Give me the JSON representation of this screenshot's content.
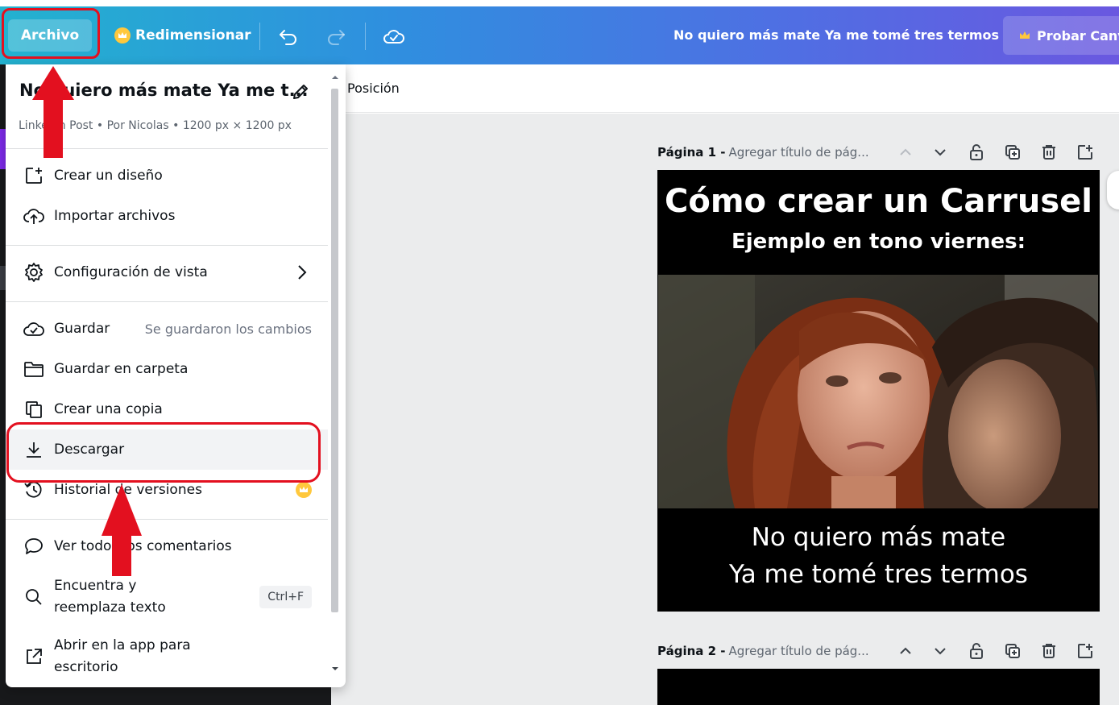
{
  "topbar": {
    "file_label": "Archivo",
    "resize_label": "Redimensionar",
    "document_title": "No quiero más mate Ya me tomé tres termos",
    "try_label": "Probar Canv",
    "gradient_colors": [
      "#23b2cf",
      "#6a58e0"
    ]
  },
  "toolbar": {
    "position_label": "Posición"
  },
  "menu": {
    "title": "No quiero más mate Ya me t...",
    "meta": "LinkedIn Post • Por Nicolas • 1200 px × 1200 px",
    "items": [
      {
        "label": "Crear un diseño",
        "icon": "add-design-icon"
      },
      {
        "label": "Importar archivos",
        "icon": "cloud-upload-icon"
      },
      {
        "label": "Configuración de vista",
        "icon": "gear-icon"
      },
      {
        "label": "Guardar",
        "icon": "cloud-check-icon",
        "status": "Se guardaron los cambios"
      },
      {
        "label": "Guardar en carpeta",
        "icon": "folder-icon"
      },
      {
        "label": "Crear una copia",
        "icon": "copy-icon"
      },
      {
        "label": "Descargar",
        "icon": "download-icon"
      },
      {
        "label": "Historial de versiones",
        "icon": "history-icon"
      },
      {
        "label": "Ver todos los comentarios",
        "icon": "comment-icon"
      },
      {
        "label": "Encuentra y reemplaza texto",
        "icon": "search-icon",
        "shortcut": "Ctrl+F"
      },
      {
        "label": "Abrir en la app para escritorio",
        "icon": "external-link-icon"
      }
    ]
  },
  "pages": [
    {
      "label": "Página 1 -",
      "title_placeholder": "Agregar título de pág...",
      "title": "Cómo crear un Carrusel",
      "subtitle": "Ejemplo en tono viernes:",
      "caption_line1": "No quiero más mate",
      "caption_line2": "Ya me tomé tres termos"
    },
    {
      "label": "Página 2 -",
      "title_placeholder": "Agregar título de pág..."
    }
  ],
  "colors": {
    "annotation_red": "#e3101f",
    "crown_gold": "#ffc83d"
  }
}
